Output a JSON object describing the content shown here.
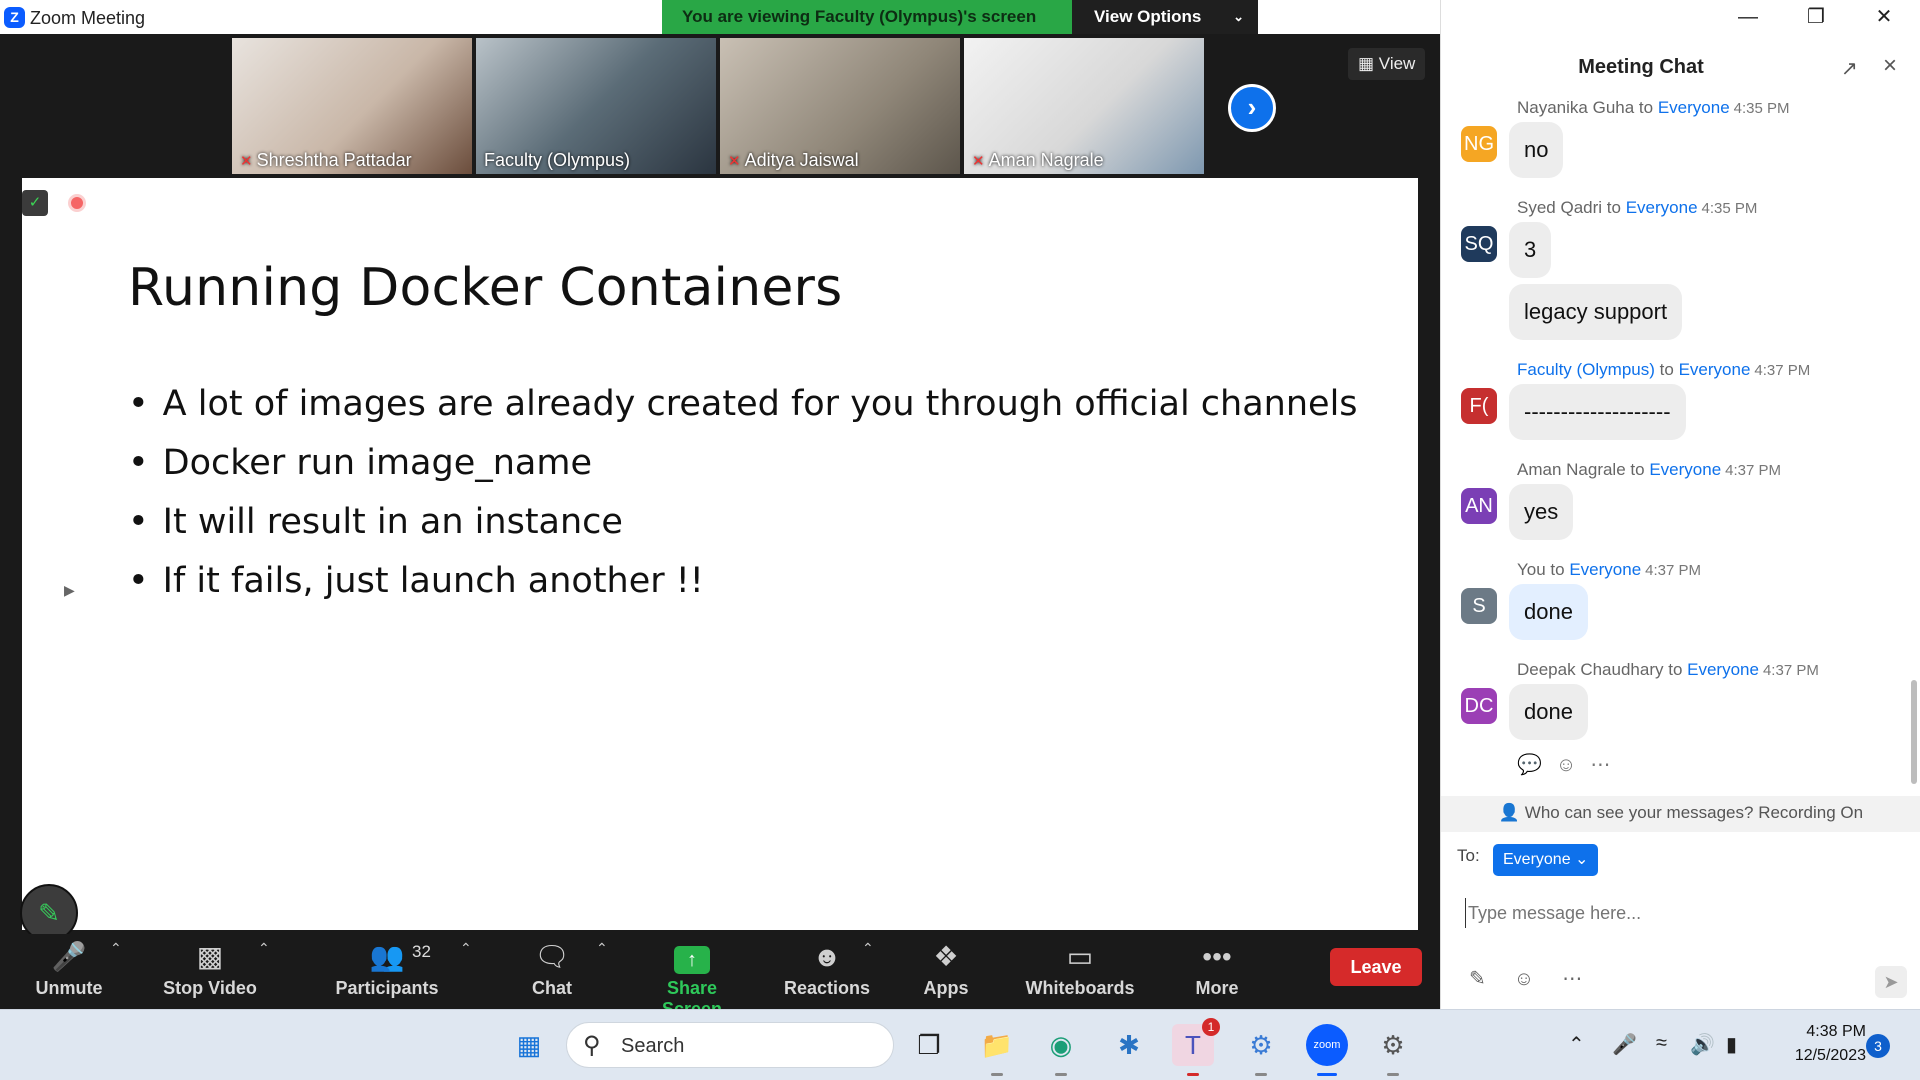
{
  "titlebar": {
    "app_title": "Zoom Meeting",
    "viewing_banner": "You are viewing Faculty (Olympus)'s screen",
    "view_options": "View Options"
  },
  "thumbnails": [
    {
      "name": "Shreshtha Pattadar",
      "muted": true
    },
    {
      "name": "Faculty (Olympus)",
      "muted": false
    },
    {
      "name": "Aditya Jaiswal",
      "muted": true
    },
    {
      "name": "Aman Nagrale",
      "muted": true
    }
  ],
  "view_label": "View",
  "slide": {
    "title": "Running Docker Containers",
    "bullets": [
      "A lot of images are already created for you through official channels",
      "Docker run image_name",
      "It will result in an instance",
      "If it fails, just launch another !!"
    ]
  },
  "toolbar": {
    "unmute": "Unmute",
    "stop_video": "Stop Video",
    "participants": "Participants",
    "participants_count": "32",
    "chat": "Chat",
    "share_screen": "Share Screen",
    "reactions": "Reactions",
    "apps": "Apps",
    "whiteboards": "Whiteboards",
    "more": "More",
    "leave": "Leave"
  },
  "chat": {
    "title": "Meeting Chat",
    "messages": [
      {
        "sender": "Nayanika Guha",
        "to": "to",
        "recipient": "Everyone",
        "time": "4:35 PM",
        "initials": "NG",
        "color": "#f5a623",
        "texts": [
          "no"
        ]
      },
      {
        "sender": "Syed Qadri",
        "to": "to",
        "recipient": "Everyone",
        "time": "4:35 PM",
        "initials": "SQ",
        "color": "#1f3a5c",
        "texts": [
          "3",
          "legacy support"
        ]
      },
      {
        "sender": "Faculty (Olympus)",
        "to": "to",
        "recipient": "Everyone",
        "time": "4:37 PM",
        "initials": "F(",
        "color": "#c62f2f",
        "texts": [
          "--------------------"
        ]
      },
      {
        "sender": "Aman Nagrale",
        "to": "to",
        "recipient": "Everyone",
        "time": "4:37 PM",
        "initials": "AN",
        "color": "#7b3fb5",
        "texts": [
          "yes"
        ]
      },
      {
        "sender": "You",
        "to": "to",
        "recipient": "Everyone",
        "time": "4:37 PM",
        "initials": "S",
        "color": "#6c7a86",
        "texts": [
          "done"
        ]
      },
      {
        "sender": "Deepak Chaudhary",
        "to": "to",
        "recipient": "Everyone",
        "time": "4:37 PM",
        "initials": "DC",
        "color": "#9b3fb5",
        "texts": [
          "done"
        ]
      }
    ],
    "notice": "Who can see your messages? Recording On",
    "to_label": "To:",
    "to_value": "Everyone",
    "input_placeholder": "Type message here..."
  },
  "taskbar": {
    "search_label": "Search",
    "time": "4:38 PM",
    "date": "12/5/2023",
    "notifications": "3",
    "teams_badge": "1"
  },
  "colors": {
    "accent": "#0e71eb",
    "banner_green": "#29a746",
    "leave_red": "#d62a2a"
  }
}
